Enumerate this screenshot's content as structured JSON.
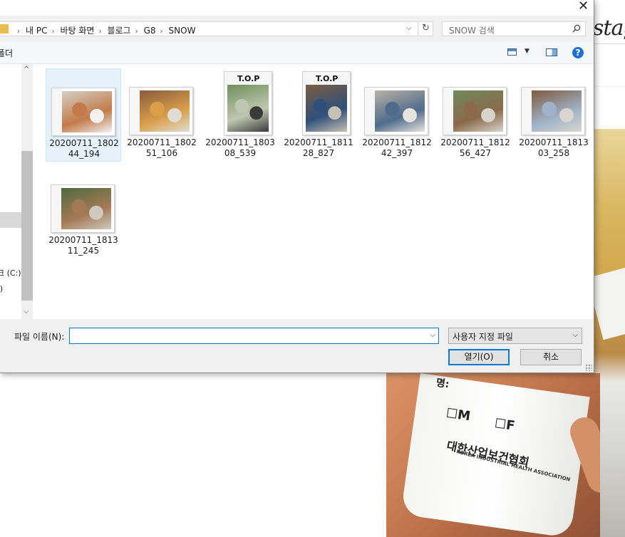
{
  "background": {
    "logo_text": "stagr",
    "cup": {
      "line1": "명:",
      "box_m": "☐M",
      "box_f": "☐F",
      "org_korean": "대한산업보건협회",
      "org_english": "KOREA INDUSTRIAL HEALTH ASSOCIATION"
    }
  },
  "dialog": {
    "close_glyph": "✕",
    "address": {
      "crumbs": [
        "내 PC",
        "바탕 화면",
        "블로그",
        "G8",
        "SNOW"
      ],
      "separator": "›",
      "dropdown_glyph": "⌵",
      "refresh_glyph": "↻"
    },
    "search": {
      "placeholder": "SNOW 검색"
    },
    "toolbar": {
      "left_label": "폴더",
      "help_glyph": "?"
    },
    "nav": {
      "drive_c": "크 (C:)",
      "drive_d": ":)"
    },
    "files": [
      {
        "name_line1": "20200711_1802",
        "name_line2": "44_194",
        "selected": true,
        "orientation": "land",
        "mag": "TOP",
        "colors": [
          "#d6d0c4",
          "#c27a4a",
          "#f2f2f2"
        ]
      },
      {
        "name_line1": "20200711_1802",
        "name_line2": "51_106",
        "selected": false,
        "orientation": "land",
        "mag": "TOP",
        "colors": [
          "#8a5a3c",
          "#d9a04a",
          "#e0ddd6"
        ]
      },
      {
        "name_line1": "20200711_1803",
        "name_line2": "08_539",
        "selected": false,
        "orientation": "port",
        "mag": "T.O.P",
        "colors": [
          "#6e8f5a",
          "#bfc7b0",
          "#3a3a3a"
        ]
      },
      {
        "name_line1": "20200711_1811",
        "name_line2": "28_827",
        "selected": false,
        "orientation": "port",
        "mag": "T.O.P",
        "colors": [
          "#7a5d43",
          "#2f4f7a",
          "#c8c2b4"
        ]
      },
      {
        "name_line1": "20200711_1812",
        "name_line2": "42_397",
        "selected": false,
        "orientation": "land",
        "mag": "TOP",
        "colors": [
          "#b9b2a6",
          "#4f6b8c",
          "#e7e4de"
        ]
      },
      {
        "name_line1": "20200711_1812",
        "name_line2": "56_427",
        "selected": false,
        "orientation": "land",
        "mag": "TOP",
        "colors": [
          "#6f8a5c",
          "#8a6a4a",
          "#d8d4cc"
        ]
      },
      {
        "name_line1": "20200711_1813",
        "name_line2": "03_258",
        "selected": false,
        "orientation": "land",
        "mag": "TOP",
        "colors": [
          "#7e5a3e",
          "#9fb3c8",
          "#dad6cf"
        ]
      },
      {
        "name_line1": "20200711_1813",
        "name_line2": "11_245",
        "selected": false,
        "orientation": "land",
        "mag": "TOP",
        "colors": [
          "#4e6a3e",
          "#a47a55",
          "#cfcac0"
        ]
      }
    ],
    "bottom": {
      "filename_label": "파일 이름(N):",
      "filename_value": "",
      "filetype": "사용자 지정 파일",
      "open_button": "열기(O)",
      "cancel_button": "취소"
    }
  }
}
